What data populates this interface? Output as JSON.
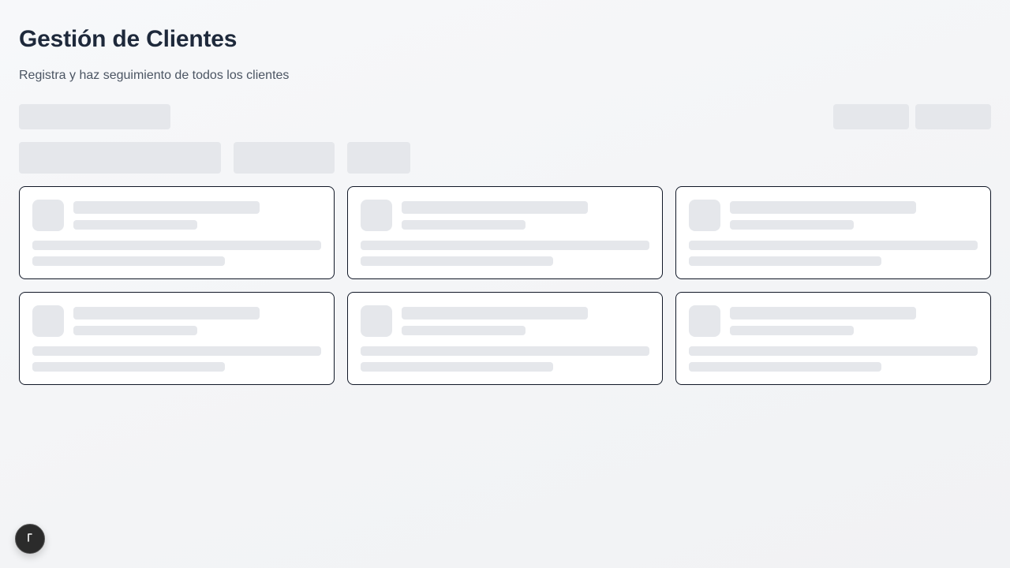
{
  "header": {
    "title": "Gestión de Clientes",
    "subtitle": "Registra y haz seguimiento de todos los clientes"
  },
  "state": "loading",
  "colors": {
    "skeleton": "#e5e7eb",
    "card_border": "#111827",
    "title": "#1e293b"
  },
  "fab": {
    "icon": "pointer-icon"
  }
}
